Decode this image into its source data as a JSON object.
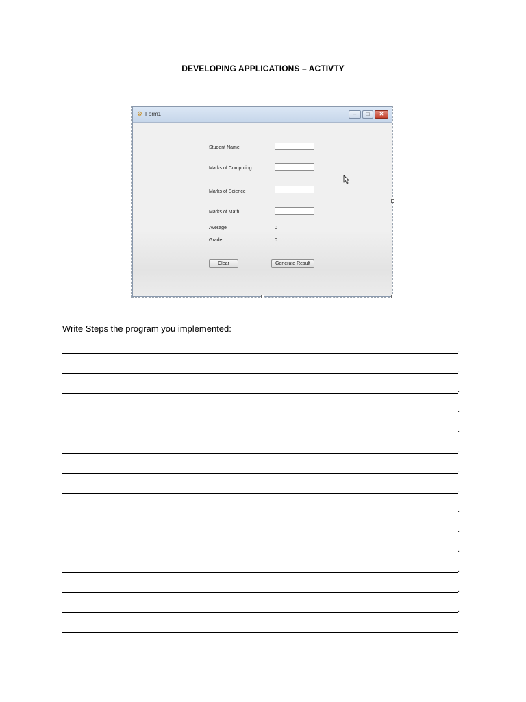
{
  "document": {
    "title": "DEVELOPING APPLICATIONS – ACTIVTY",
    "instruction": "Write Steps the program you implemented:",
    "line_terminator": ".",
    "answer_line_count": 15
  },
  "form": {
    "window_title": "Form1",
    "title_buttons": {
      "minimize": "–",
      "maximize": "□",
      "close": "✕"
    },
    "icons": [
      "app-icon",
      "minimize-icon",
      "maximize-icon",
      "close-icon",
      "mouse-cursor-icon"
    ],
    "fields": [
      {
        "label": "Student Name",
        "value": ""
      },
      {
        "label": "Marks of Computing",
        "value": ""
      },
      {
        "label": "Marks of Science",
        "value": ""
      },
      {
        "label": "Marks of Math",
        "value": ""
      }
    ],
    "outputs": [
      {
        "label": "Average",
        "value": "0"
      },
      {
        "label": "Grade",
        "value": "0"
      }
    ],
    "buttons": {
      "clear": "Clear",
      "generate": "Generate Result"
    }
  }
}
